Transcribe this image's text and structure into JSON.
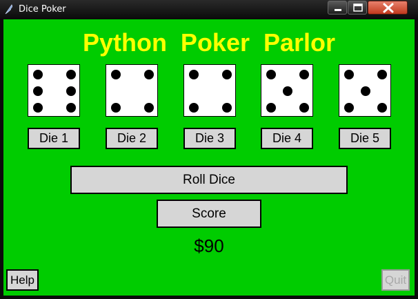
{
  "window": {
    "title": "Dice Poker",
    "icon": "feather-icon",
    "controls": [
      "minimize-icon",
      "maximize-icon",
      "close-icon"
    ]
  },
  "heading": "Python  Poker  Parlor",
  "dice": [
    {
      "value": 6,
      "label": "Die 1"
    },
    {
      "value": 4,
      "label": "Die 2"
    },
    {
      "value": 4,
      "label": "Die 3"
    },
    {
      "value": 5,
      "label": "Die 4"
    },
    {
      "value": 5,
      "label": "Die 5"
    }
  ],
  "buttons": {
    "roll": "Roll Dice",
    "score": "Score",
    "help": "Help",
    "quit": "Quit",
    "quit_enabled": false
  },
  "money": "$90",
  "colors": {
    "background": "#00cc00",
    "heading": "#ffff00",
    "button": "#d6d6d6"
  }
}
